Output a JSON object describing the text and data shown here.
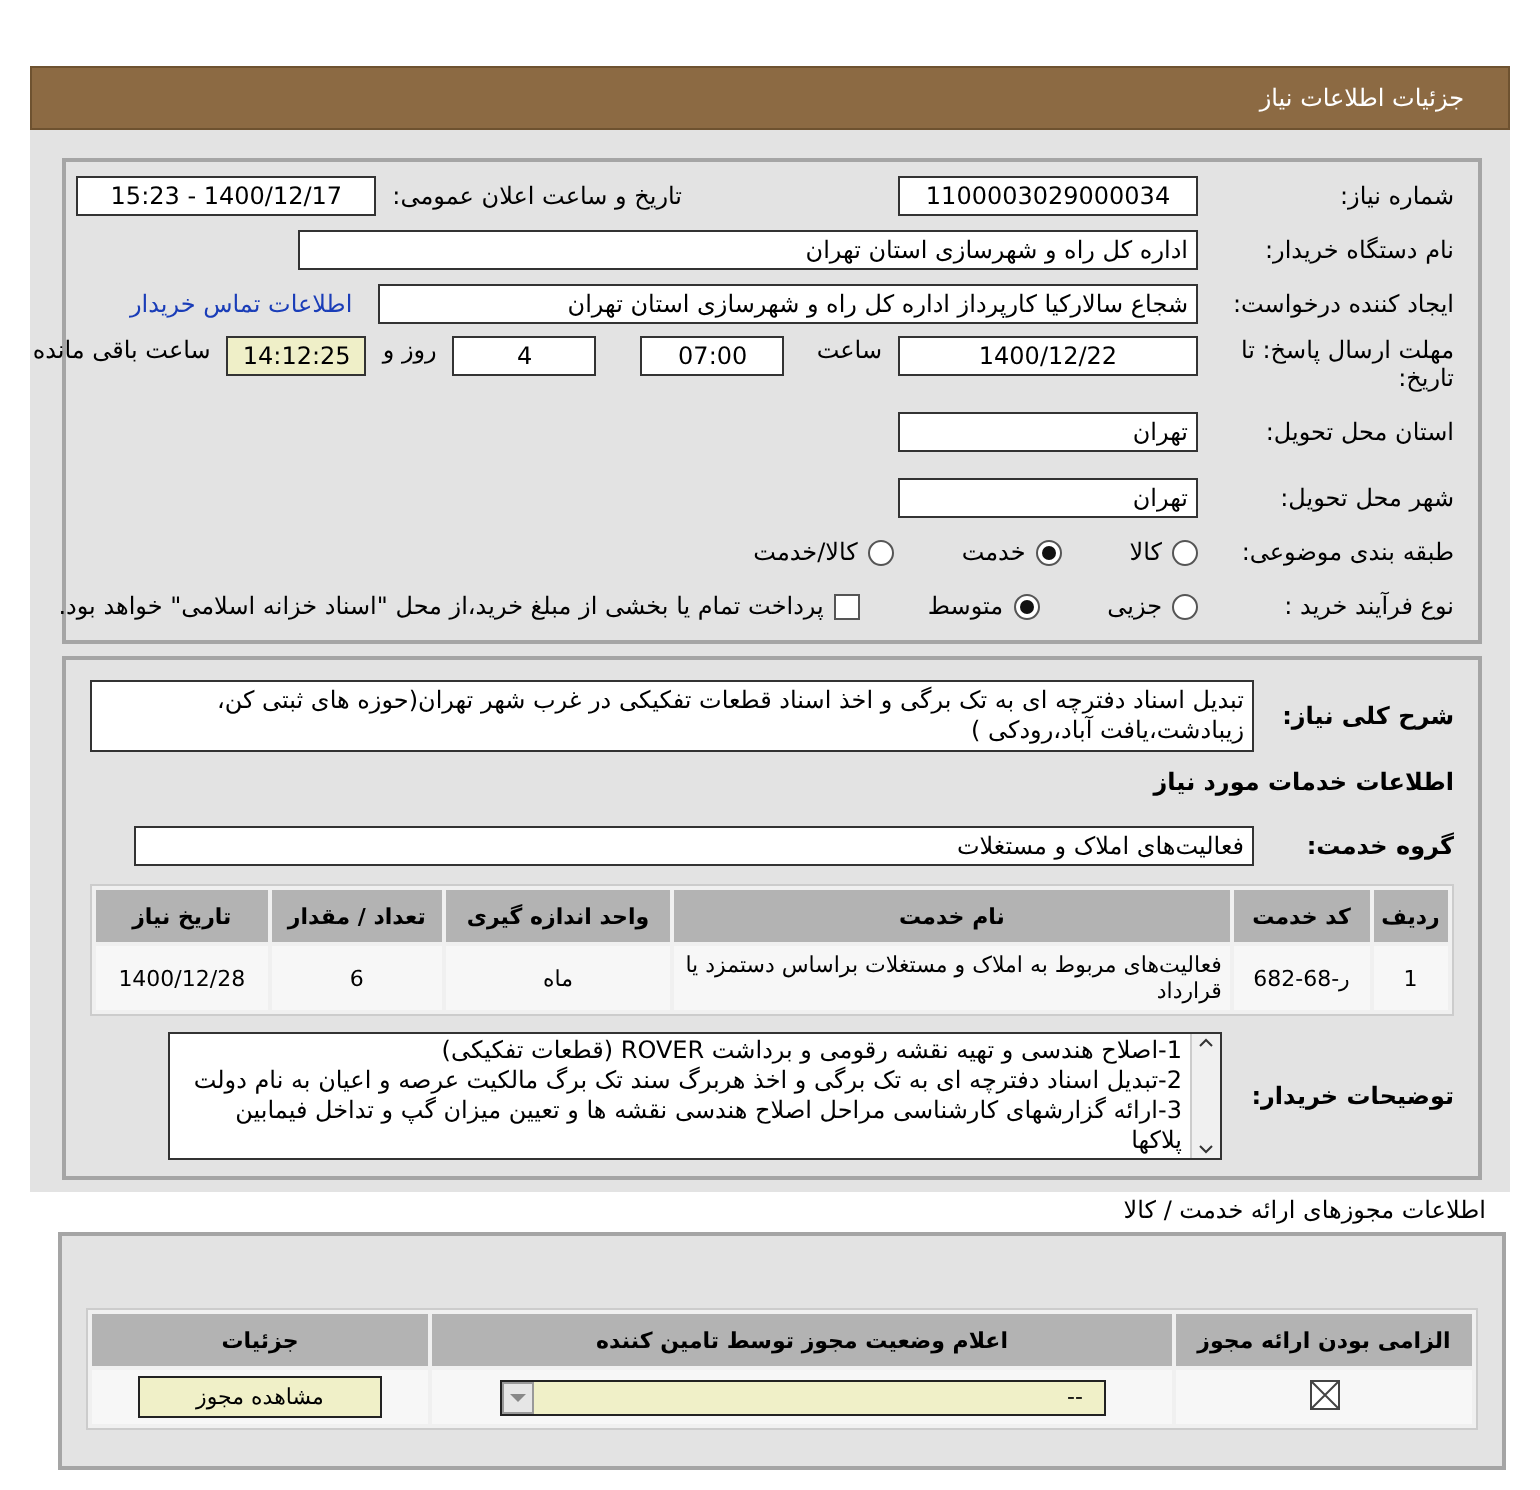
{
  "header": {
    "title": "جزئیات اطلاعات نیاز"
  },
  "details": {
    "need_number": {
      "label": "شماره نیاز:",
      "value": "1100003029000034"
    },
    "announce": {
      "label": "تاریخ و ساعت اعلان عمومی:",
      "value": "1400/12/17 - 15:23"
    },
    "buyer_org": {
      "label": "نام دستگاه خریدار:",
      "value": "اداره کل راه و شهرسازی استان تهران"
    },
    "requester": {
      "label": "ایجاد کننده درخواست:",
      "value": "شجاع سالارکیا کارپرداز اداره کل راه و شهرسازی استان تهران",
      "link": "اطلاعات تماس خریدار"
    },
    "deadline": {
      "label": "مهلت ارسال پاسخ: تا تاریخ:",
      "date": "1400/12/22",
      "time_label": "ساعت",
      "time": "07:00",
      "days": "4",
      "days_label": "روز و",
      "remaining": "14:12:25",
      "remaining_label": "ساعت باقی مانده"
    },
    "province": {
      "label": "استان محل تحویل:",
      "value": "تهران"
    },
    "city": {
      "label": "شهر محل تحویل:",
      "value": "تهران"
    },
    "category": {
      "label": "طبقه بندی موضوعی:",
      "options": [
        {
          "label": "کالا",
          "selected": false
        },
        {
          "label": "خدمت",
          "selected": true
        },
        {
          "label": "کالا/خدمت",
          "selected": false
        }
      ]
    },
    "process": {
      "label": "نوع فرآیند خرید :",
      "options": [
        {
          "label": "جزیی",
          "selected": false
        },
        {
          "label": "متوسط",
          "selected": true
        }
      ],
      "payment": {
        "checked": false,
        "label": "پرداخت تمام یا بخشی از مبلغ خرید،از محل \"اسناد خزانه اسلامی\" خواهد بود."
      }
    }
  },
  "need": {
    "description_label": "شرح کلی نیاز:",
    "description": "تبدیل اسناد دفترچه ای به تک برگی و اخذ اسناد قطعات تفکیکی در غرب شهر تهران(حوزه های ثبتی کن، زیبادشت،یافت آباد،رودکی )",
    "services_title": "اطلاعات خدمات مورد نیاز",
    "group_label": "گروه خدمت:",
    "group": "فعالیت‌های  املاک و مستغلات",
    "table": {
      "columns": [
        "ردیف",
        "کد خدمت",
        "نام خدمت",
        "واحد اندازه گیری",
        "تعداد / مقدار",
        "تاریخ نیاز"
      ],
      "rows": [
        [
          "1",
          "ر-68-682",
          "فعالیت‌های مربوط به املاک و مستغلات براساس دستمزد یا قرارداد",
          "ماه",
          "6",
          "1400/12/28"
        ]
      ]
    },
    "notes_label": "توضیحات خریدار:",
    "notes": [
      "1-اصلاح هندسی و تهیه نقشه رقومی و برداشت ROVER  (قطعات تفکیکی)",
      "2-تبدیل اسناد دفترچه ای به تک برگی و اخذ هربرگ سند تک برگ مالکیت  عرصه و اعیان به نام دولت",
      "3-ارائه گزارشهای کارشناسی مراحل اصلاح هندسی نقشه ها و تعیین میزان گپ و تداخل فیمابین پلاکها"
    ]
  },
  "permits": {
    "title": "اطلاعات مجوزهای ارائه خدمت / کالا",
    "columns": [
      "الزامی بودن ارائه مجوز",
      "اعلام وضعیت مجوز توسط تامین کننده",
      "جزئیات"
    ],
    "rows": [
      {
        "required": true,
        "status": "--",
        "button": "مشاهده مجوز"
      }
    ]
  }
}
